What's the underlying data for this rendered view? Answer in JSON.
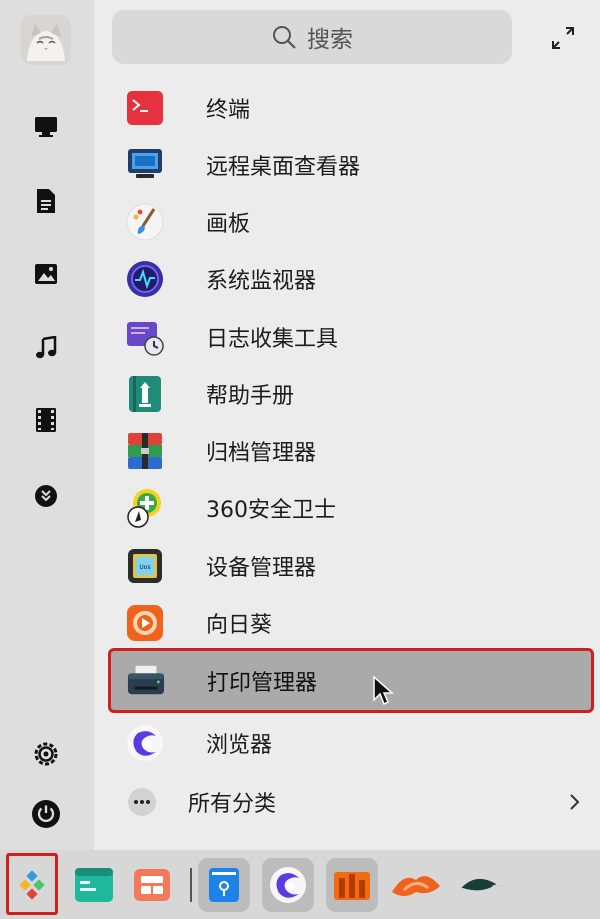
{
  "search": {
    "label": "搜索",
    "icon": "search-icon"
  },
  "sidebar": {
    "items": [
      {
        "name": "computer",
        "icon": "monitor-icon"
      },
      {
        "name": "documents",
        "icon": "document-icon"
      },
      {
        "name": "pictures",
        "icon": "image-icon"
      },
      {
        "name": "music",
        "icon": "music-icon"
      },
      {
        "name": "videos",
        "icon": "film-icon"
      },
      {
        "name": "downloads",
        "icon": "download-icon"
      },
      {
        "name": "settings",
        "icon": "gear-icon"
      },
      {
        "name": "power",
        "icon": "power-icon"
      }
    ]
  },
  "apps": [
    {
      "label": "终端",
      "icon": "terminal-icon"
    },
    {
      "label": "远程桌面查看器",
      "icon": "remote-desktop-icon"
    },
    {
      "label": "画板",
      "icon": "paint-brush-icon"
    },
    {
      "label": "系统监视器",
      "icon": "system-monitor-icon"
    },
    {
      "label": "日志收集工具",
      "icon": "log-collector-icon"
    },
    {
      "label": "帮助手册",
      "icon": "help-manual-icon"
    },
    {
      "label": "归档管理器",
      "icon": "archive-manager-icon"
    },
    {
      "label": "360安全卫士",
      "icon": "360-security-icon"
    },
    {
      "label": "设备管理器",
      "icon": "device-manager-icon"
    },
    {
      "label": "向日葵",
      "icon": "sunflower-icon"
    },
    {
      "label": "打印管理器",
      "icon": "printer-icon",
      "selected": true
    },
    {
      "label": "浏览器",
      "icon": "browser-icon"
    }
  ],
  "all_categories": {
    "label": "所有分类",
    "icon": "more-dots-icon",
    "arrow": "chevron-right-icon"
  },
  "taskbar": {
    "items": [
      {
        "name": "launcher",
        "icon": "launcher-icon"
      },
      {
        "name": "terminal-app",
        "icon": "terminal-app-icon"
      },
      {
        "name": "multitask-view",
        "icon": "multitask-icon"
      },
      {
        "name": "file-manager",
        "icon": "file-manager-icon"
      },
      {
        "name": "browser",
        "icon": "browser-icon"
      },
      {
        "name": "app-store",
        "icon": "app-store-icon"
      },
      {
        "name": "music-app",
        "icon": "music-app-icon"
      },
      {
        "name": "tray-app",
        "icon": "tray-app-icon"
      }
    ]
  },
  "colors": {
    "highlight": "#d0201d",
    "selected_bg": "#aaaaaa"
  }
}
